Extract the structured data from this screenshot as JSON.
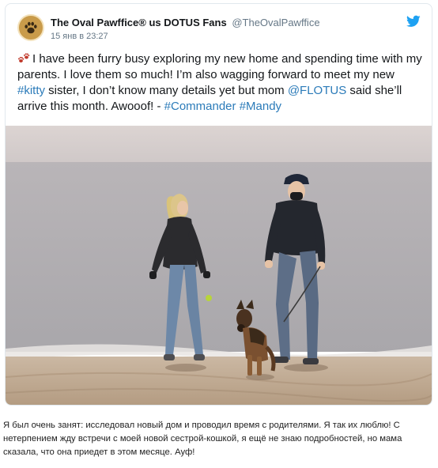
{
  "tweet": {
    "display_name": "The Oval Pawffice® us DOTUS Fans",
    "handle": "@TheOvalPawffice",
    "timestamp": "15 янв в 23:27",
    "avatar_icon": "paw-print-icon",
    "brand_icon": "twitter-bird-icon",
    "brand_color": "#1da1f2",
    "link_color": "#2b7bb9",
    "text": {
      "part1": "I have been furry busy exploring my new home and spending time with my parents. I love them so much! I’m also wagging forward to meet my new ",
      "hashtag_kitty": "#kitty",
      "part2": " sister, I don’t know many details yet but mom ",
      "mention_flotus": "@FLOTUS",
      "part3": " said she’ll arrive this month. Awooof! - ",
      "hashtag_commander": "#Commander",
      "part4": " ",
      "hashtag_mandy": "#Mandy"
    },
    "photo_icon": "beach-walk-photo"
  },
  "caption": "Я был очень занят: исследовал новый дом и проводил время с родителями. Я так их люблю! С нетерпением жду встречи с моей новой сестрой-кошкой, я ещё не знаю подробностей, но мама сказала, что она приедет в этом месяце. Ауф!"
}
